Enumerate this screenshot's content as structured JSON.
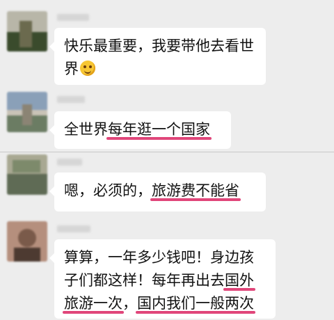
{
  "messages": [
    {
      "lines": [
        {
          "segments": [
            {
              "text": "快乐最重要，我要带他去看世",
              "hl": false
            }
          ]
        },
        {
          "segments": [
            {
              "text": "界",
              "hl": false
            }
          ]
        }
      ],
      "emoji": "thinking-face-emoji",
      "avatar_colors": [
        "#6b6a4e",
        "#3a4b2c",
        "#b8b6a8"
      ]
    },
    {
      "lines": [
        {
          "segments": [
            {
              "text": "全世界",
              "hl": false
            },
            {
              "text": "每年逛一个国家",
              "hl": true
            }
          ]
        }
      ],
      "avatar_colors": [
        "#8aa0b8",
        "#6b7c63",
        "#c9c3b7"
      ]
    },
    {
      "lines": [
        {
          "segments": [
            {
              "text": "嗯，必须的，",
              "hl": false
            },
            {
              "text": "旅游费不能省",
              "hl": true
            }
          ]
        }
      ],
      "avatar_colors": [
        "#7d8a6b",
        "#a8a892",
        "#5f6b55"
      ]
    },
    {
      "lines": [
        {
          "segments": [
            {
              "text": "算算，一年多少钱吧！身边孩",
              "hl": false
            }
          ]
        },
        {
          "segments": [
            {
              "text": "子们都这样！每年再出去",
              "hl": false
            },
            {
              "text": "国外",
              "hl": true
            }
          ]
        },
        {
          "segments": [
            {
              "text": "旅游一次",
              "hl": true
            },
            {
              "text": "，",
              "hl": false
            },
            {
              "text": "国内我们一般两次",
              "hl": true
            }
          ]
        }
      ],
      "avatar_colors": [
        "#7a5a4a",
        "#b58f7d",
        "#4d3a31"
      ]
    }
  ],
  "colors": {
    "background": "#ededed",
    "bubble": "#ffffff",
    "highlight_underline": "#e0467a"
  }
}
